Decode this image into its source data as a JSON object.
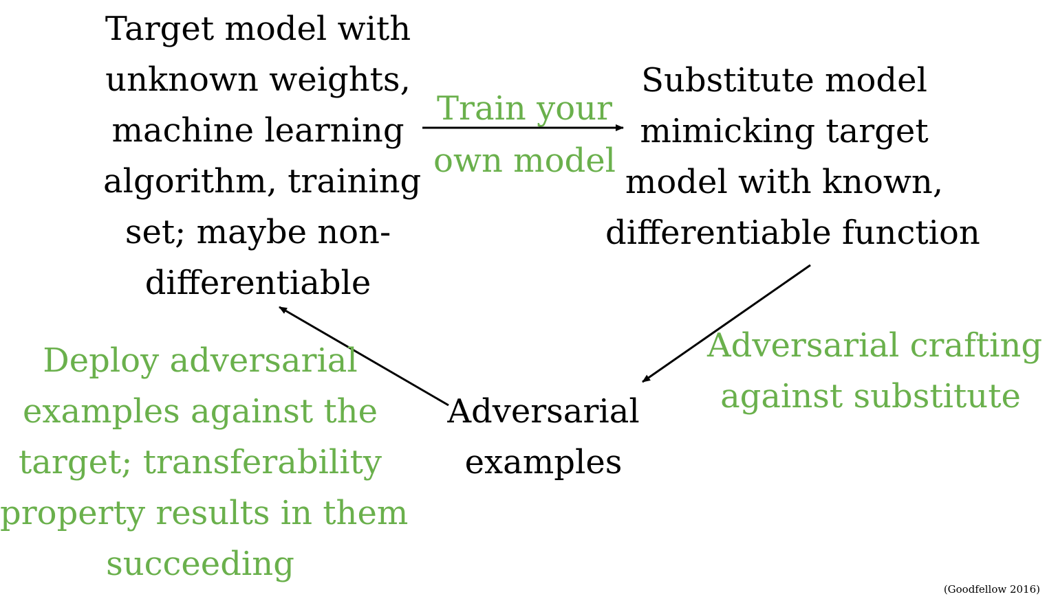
{
  "nodes": {
    "target": {
      "lines": [
        "Target model with",
        "unknown weights,",
        "machine learning",
        "algorithm, training",
        "set; maybe non-",
        "differentiable"
      ]
    },
    "substitute": {
      "lines": [
        "Substitute model",
        "mimicking target",
        "model with known,",
        "differentiable function"
      ]
    },
    "adversarial": {
      "lines": [
        "Adversarial",
        "examples"
      ]
    }
  },
  "edges": {
    "train": {
      "lines": [
        "Train your",
        "own model"
      ]
    },
    "crafting": {
      "lines": [
        "Adversarial crafting",
        "against substitute"
      ]
    },
    "deploy": {
      "lines": [
        "Deploy adversarial",
        "examples against the",
        "target; transferability",
        "property results in them",
        "succeeding"
      ]
    }
  },
  "citation": "(Goodfellow 2016)",
  "colors": {
    "node_text": "#000000",
    "edge_text": "#6ab04c",
    "arrow": "#000000"
  }
}
